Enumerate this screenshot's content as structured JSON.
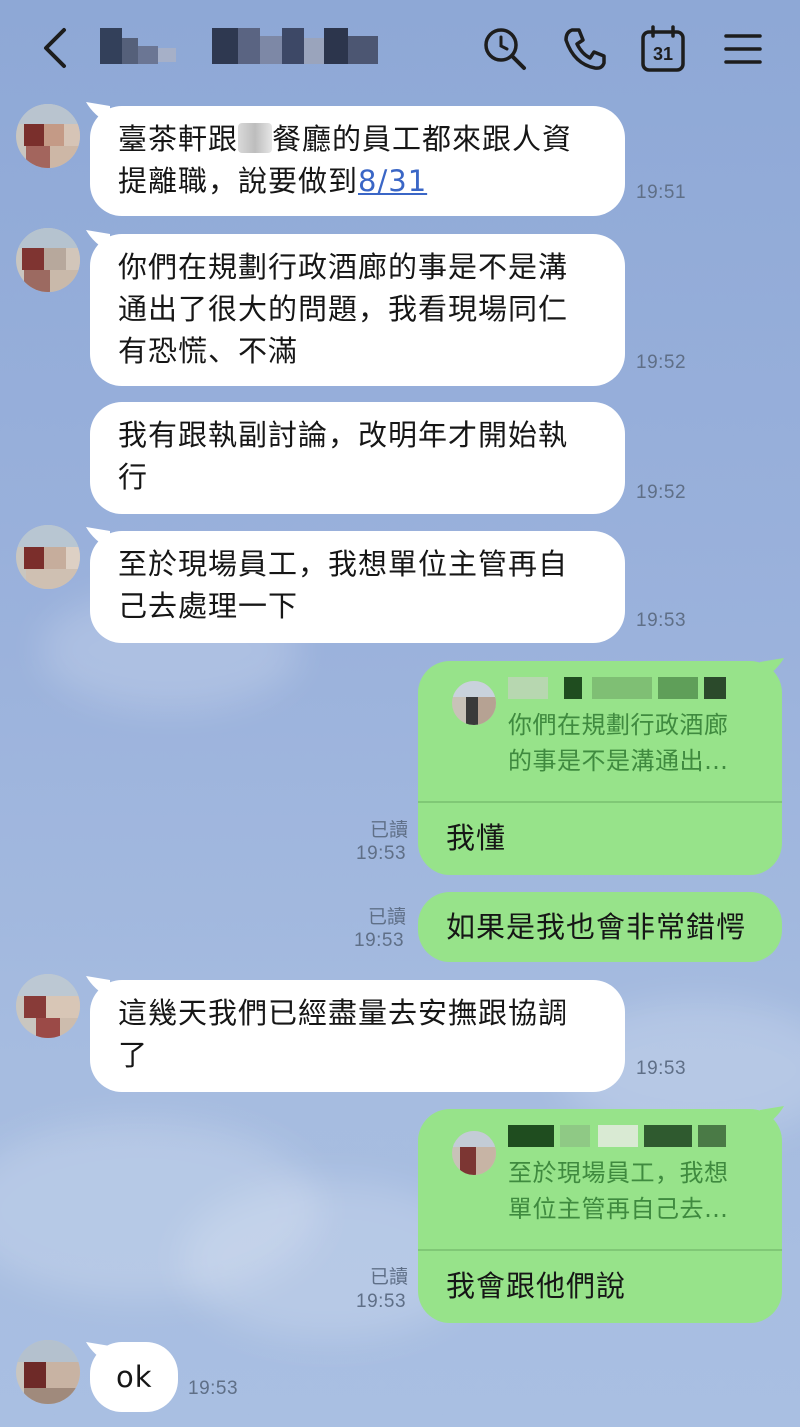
{
  "header": {
    "search_icon": "search-icon",
    "phone_icon": "phone-icon",
    "calendar_day": "31",
    "menu_icon": "menu-icon",
    "back_icon": "chevron-left-icon"
  },
  "messages": [
    {
      "dir": "in",
      "pre": "",
      "text_a": "臺茶軒跟",
      "text_b": "餐廳的員工都來跟人資\n提離職，說要做到",
      "link": "8/31",
      "time": "19:51"
    },
    {
      "dir": "in",
      "text": "你們在規劃行政酒廊的事是不是溝\n通出了很大的問題，我看現場同仁\n有恐慌、不滿",
      "time": "19:52"
    },
    {
      "dir": "in",
      "text": "我有跟執副討論，改明年才開始執\n行",
      "time": "19:52"
    },
    {
      "dir": "in",
      "text": "至於現場員工，我想單位主管再自\n己去處理一下",
      "time": "19:53"
    },
    {
      "dir": "out",
      "quote": "你們在規劃行政酒廊\n的事是不是溝通出…",
      "text": "我懂",
      "read": "已讀",
      "time": "19:53"
    },
    {
      "dir": "out",
      "text": "如果是我也會非常錯愕",
      "read": "已讀",
      "time": "19:53"
    },
    {
      "dir": "in",
      "text": "這幾天我們已經盡量去安撫跟協調\n了",
      "time": "19:53"
    },
    {
      "dir": "out",
      "quote": "至於現場員工，我想\n單位主管再自己去…",
      "text": "我會跟他們說",
      "read": "已讀",
      "time": "19:53"
    },
    {
      "dir": "in",
      "text": "ok",
      "time": "19:53"
    }
  ],
  "colors": {
    "incoming": "#ffffff",
    "outgoing": "#97e38a",
    "background": "#9bb2dc",
    "link": "#3a66c6",
    "quote_text": "#3f8a3f"
  }
}
